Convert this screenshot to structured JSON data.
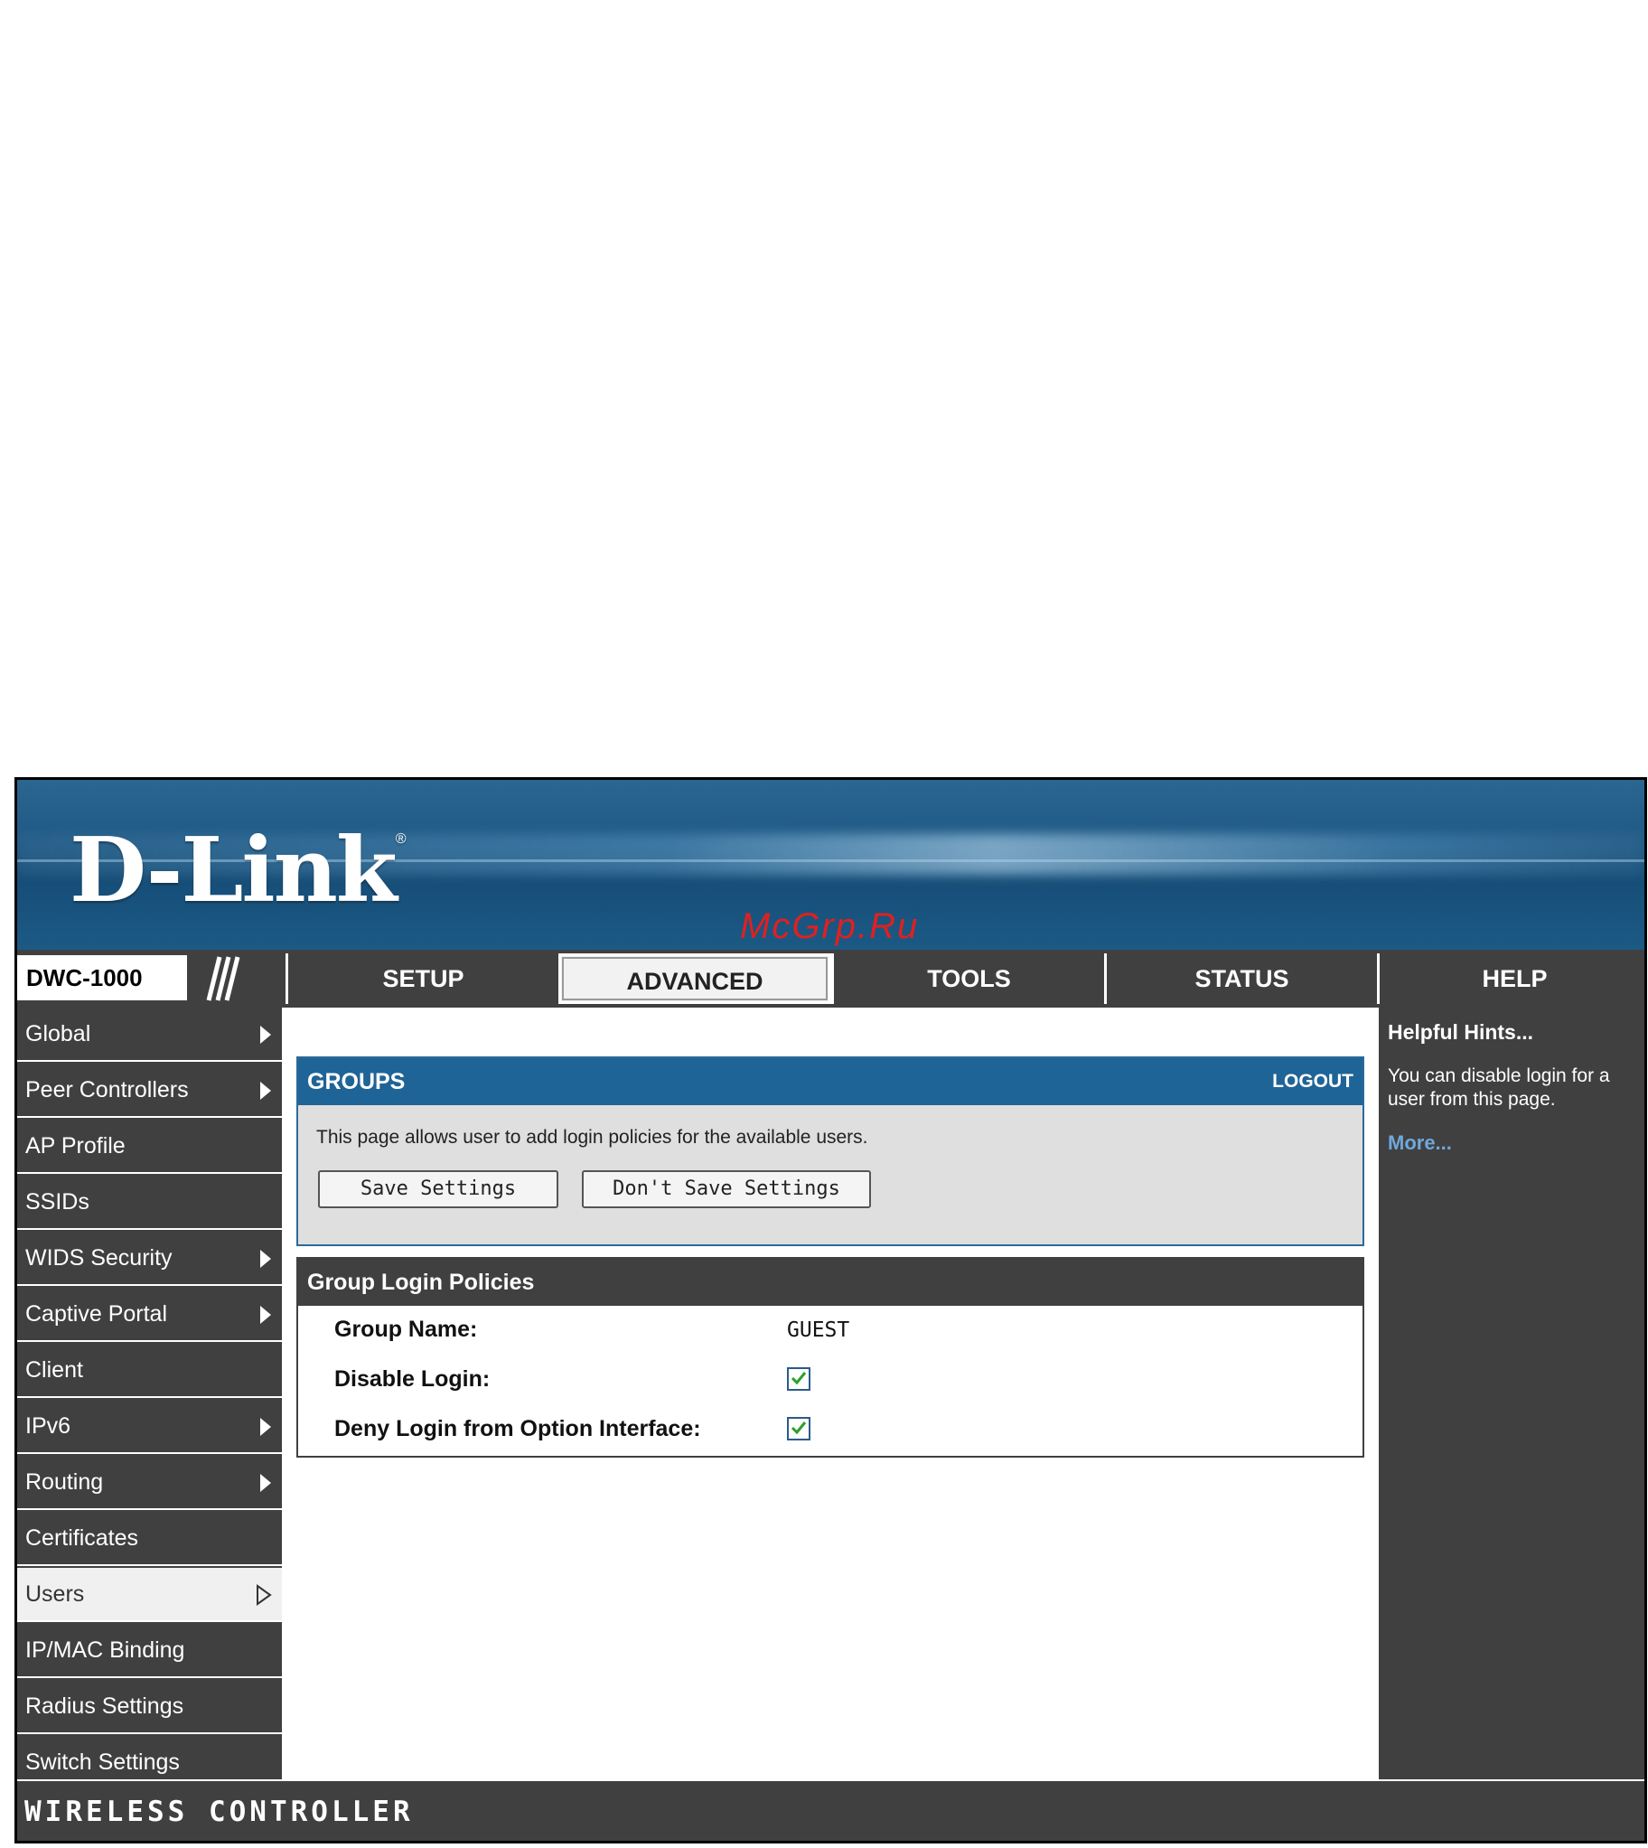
{
  "brand": {
    "logo": "D-Link",
    "registered": "®",
    "watermark": "McGrp.Ru"
  },
  "header": {
    "model": "DWC-1000"
  },
  "nav": {
    "tabs": [
      "SETUP",
      "ADVANCED",
      "TOOLS",
      "STATUS",
      "HELP"
    ],
    "active": "ADVANCED"
  },
  "sidebar": {
    "items": [
      {
        "label": "Global",
        "arrow": true
      },
      {
        "label": "Peer Controllers",
        "arrow": true
      },
      {
        "label": "AP Profile",
        "arrow": false
      },
      {
        "label": "SSIDs",
        "arrow": false
      },
      {
        "label": "WIDS Security",
        "arrow": true
      },
      {
        "label": "Captive Portal",
        "arrow": true
      },
      {
        "label": "Client",
        "arrow": false
      },
      {
        "label": "IPv6",
        "arrow": true
      },
      {
        "label": "Routing",
        "arrow": true
      },
      {
        "label": "Certificates",
        "arrow": false
      },
      {
        "label": "Users",
        "arrow": true,
        "active": true
      },
      {
        "label": "IP/MAC Binding",
        "arrow": false
      },
      {
        "label": "Radius Settings",
        "arrow": false
      },
      {
        "label": "Switch Settings",
        "arrow": false
      }
    ]
  },
  "groups": {
    "title": "GROUPS",
    "logout": "LOGOUT",
    "description": "This page allows user to add login policies for the available users.",
    "save_label": "Save Settings",
    "dont_save_label": "Don't Save Settings"
  },
  "policies": {
    "title": "Group Login Policies",
    "group_name_label": "Group Name:",
    "group_name_value": "GUEST",
    "disable_login_label": "Disable Login:",
    "disable_login_checked": true,
    "deny_login_label": "Deny Login from Option Interface:",
    "deny_login_checked": true
  },
  "help": {
    "title": "Helpful Hints...",
    "text": "You can disable login for a user from this page.",
    "more": "More..."
  },
  "footer": {
    "text": "WIRELESS CONTROLLER"
  },
  "colors": {
    "banner": "#1f5a86",
    "dark": "#404040",
    "accent": "#1f6496",
    "link": "#6fa8dc"
  }
}
